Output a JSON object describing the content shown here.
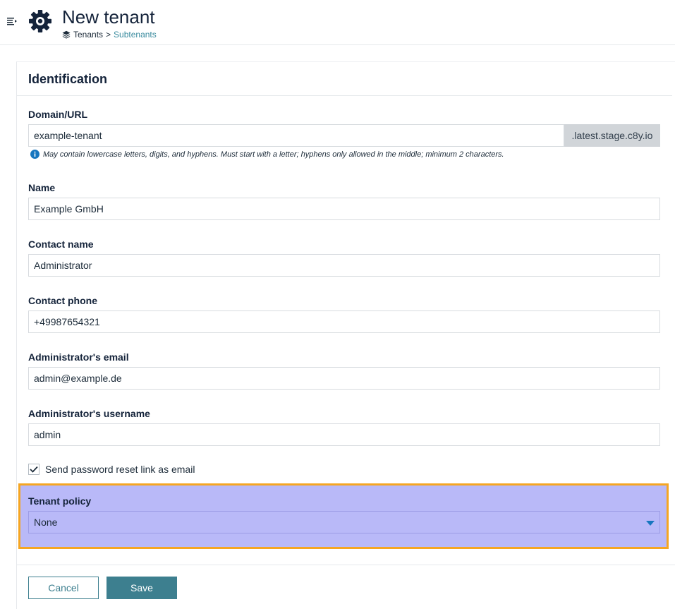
{
  "header": {
    "title": "New tenant",
    "breadcrumb": {
      "root": "Tenants",
      "separator": ">",
      "current": "Subtenants"
    }
  },
  "card": {
    "title": "Identification"
  },
  "form": {
    "domain": {
      "label": "Domain/URL",
      "value": "example-tenant",
      "suffix": ".latest.stage.c8y.io",
      "help": "May contain lowercase letters, digits, and hyphens. Must start with a letter; hyphens only allowed in the middle; minimum 2 characters."
    },
    "name": {
      "label": "Name",
      "value": "Example GmbH"
    },
    "contact_name": {
      "label": "Contact name",
      "value": "Administrator"
    },
    "contact_phone": {
      "label": "Contact phone",
      "value": "+49987654321"
    },
    "admin_email": {
      "label": "Administrator's email",
      "value": "admin@example.de"
    },
    "admin_username": {
      "label": "Administrator's username",
      "value": "admin"
    },
    "send_reset": {
      "label": "Send password reset link as email",
      "checked": true
    },
    "tenant_policy": {
      "label": "Tenant policy",
      "selected": "None"
    }
  },
  "buttons": {
    "cancel": "Cancel",
    "save": "Save"
  },
  "colors": {
    "accent": "#3d7f8f",
    "link": "#3a8b9e",
    "highlight_fill": "#b9b9f8",
    "highlight_border": "#f5a623",
    "info_icon": "#1776bf"
  },
  "icons": {
    "menu": "menu-toggle-icon",
    "app": "gear-icon",
    "breadcrumb": "layers-icon",
    "help": "info-icon",
    "checkbox": "check-icon",
    "select": "caret-down-icon"
  }
}
